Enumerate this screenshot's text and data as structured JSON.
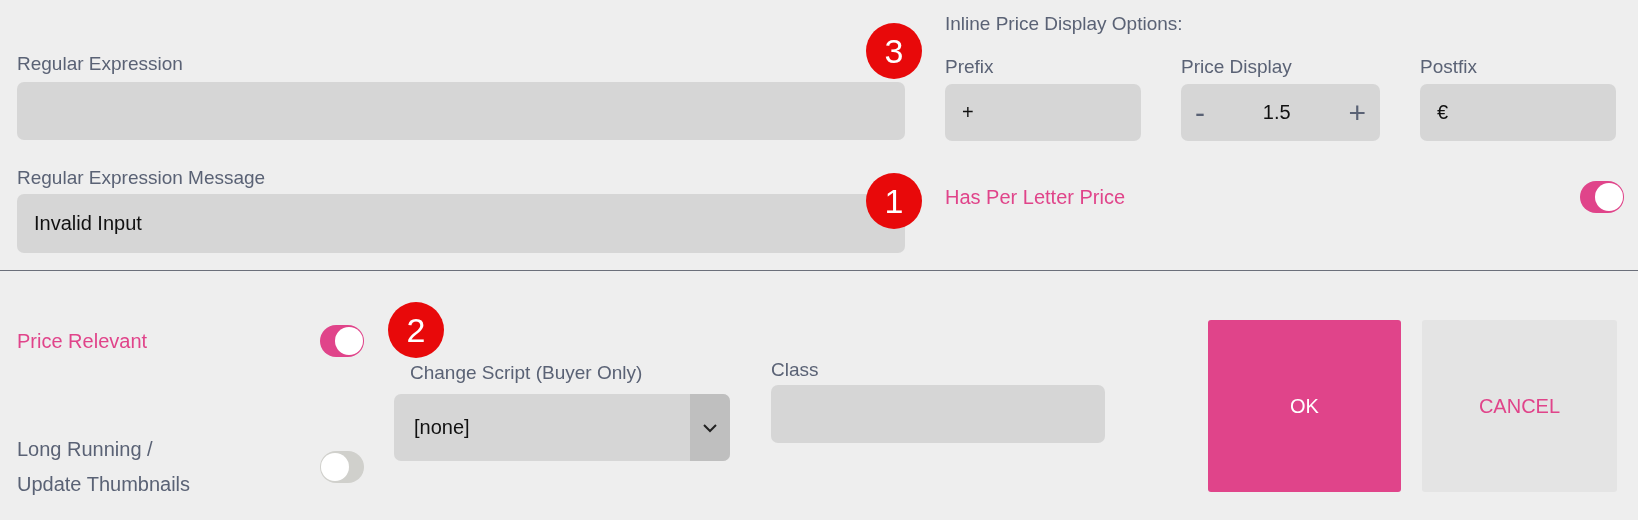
{
  "regex": {
    "label": "Regular Expression"
  },
  "regex_message": {
    "label": "Regular Expression Message",
    "value": "Invalid Input"
  },
  "inline_price": {
    "title": "Inline Price Display Options:",
    "prefix": {
      "label": "Prefix",
      "value": "+"
    },
    "price_display": {
      "label": "Price Display",
      "minus": "-",
      "value": "1.5",
      "plus": "+"
    },
    "postfix": {
      "label": "Postfix",
      "value": "€"
    }
  },
  "has_per_letter_price": {
    "label": "Has Per Letter Price",
    "on": true
  },
  "price_relevant": {
    "label": "Price Relevant",
    "on": true
  },
  "long_running": {
    "label": "Long Running / Update Thumbnails",
    "on": false
  },
  "change_script": {
    "label": "Change Script (Buyer Only)",
    "value": "[none]"
  },
  "class_field": {
    "label": "Class"
  },
  "buttons": [
    {
      "label": "OK",
      "kind": "primary"
    },
    {
      "label": "CANCEL",
      "kind": "secondary"
    }
  ],
  "badges": [
    {
      "number": "3"
    },
    {
      "number": "1"
    },
    {
      "number": "2"
    }
  ]
}
